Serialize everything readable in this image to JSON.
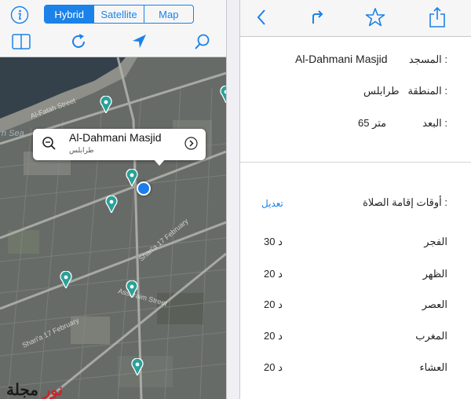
{
  "map_panel": {
    "segments": [
      "Hybrid",
      "Satellite",
      "Map"
    ],
    "active_segment": "Hybrid",
    "sea_label": "n Sea",
    "callout": {
      "title": "Al-Dahmani Masjid",
      "subtitle": "طرابلس"
    }
  },
  "details": {
    "mosque_label": "المسجد :",
    "mosque_value": "Al-Dahmani Masjid",
    "region_label": "المنطقة :",
    "region_value": "طرابلس",
    "distance_label": "البعد :",
    "distance_value": "65 متر",
    "prayer_times_label": "أوقات إقامة الصلاة :",
    "edit_label": "تعديل",
    "prayers": [
      {
        "name": "الفجر",
        "value": "30 د"
      },
      {
        "name": "الظهر",
        "value": "20 د"
      },
      {
        "name": "العصر",
        "value": "20 د"
      },
      {
        "name": "المغرب",
        "value": "20 د"
      },
      {
        "name": "العشاء",
        "value": "20 د"
      }
    ]
  },
  "watermark": {
    "part1": "نور",
    "part2": "مجلة"
  },
  "colors": {
    "accent": "#1a82e8",
    "pin": "#2aa198",
    "user_location": "#1a7df0",
    "watermark_red": "#c7262c"
  },
  "icons": [
    "info-icon",
    "book-icon",
    "refresh-icon",
    "location-arrow-icon",
    "search-icon",
    "zoom-icon",
    "chevron-right-icon",
    "back-chevron-icon",
    "forward-arrow-icon",
    "star-icon",
    "share-icon",
    "mosque-pin-icon"
  ]
}
